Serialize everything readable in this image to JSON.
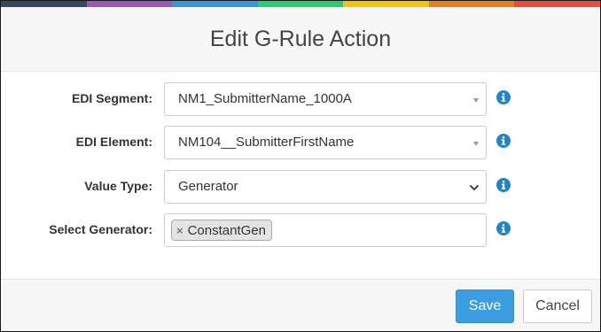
{
  "header": {
    "title": "Edit G-Rule Action"
  },
  "color_bar": [
    "#34495e",
    "#9b59b6",
    "#3498db",
    "#2ecc71",
    "#f1c40f",
    "#e67e22",
    "#e74c3c"
  ],
  "form": {
    "edi_segment": {
      "label": "EDI Segment:",
      "value": "NM1_SubmitterName_1000A",
      "icon": "info-icon"
    },
    "edi_element": {
      "label": "EDI Element:",
      "value": "NM104__SubmitterFirstName",
      "icon": "info-icon"
    },
    "value_type": {
      "label": "Value Type:",
      "value": "Generator",
      "icon": "info-icon"
    },
    "select_generator": {
      "label": "Select Generator:",
      "tag": "ConstantGen",
      "tag_remove": "×",
      "icon": "info-icon"
    }
  },
  "footer": {
    "save_label": "Save",
    "cancel_label": "Cancel"
  },
  "colors": {
    "accent": "#3c9ee0",
    "info_icon": "#1f85c9"
  }
}
